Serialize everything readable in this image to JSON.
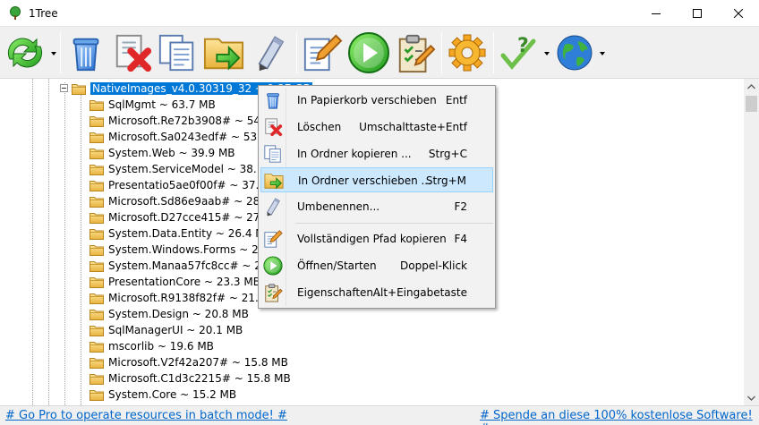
{
  "window": {
    "title": "1Tree"
  },
  "toolbar": {
    "buttons": [
      {
        "id": "refresh",
        "icon": "refresh-icon",
        "has_dropdown": true
      },
      {
        "id": "recycle",
        "icon": "recycle-bin-icon"
      },
      {
        "id": "delete",
        "icon": "delete-icon"
      },
      {
        "id": "copy",
        "icon": "copy-icon"
      },
      {
        "id": "move",
        "icon": "move-folder-icon"
      },
      {
        "id": "rename",
        "icon": "pencil-icon"
      },
      {
        "id": "copy-path",
        "icon": "edit-document-icon"
      },
      {
        "id": "open",
        "icon": "play-icon"
      },
      {
        "id": "properties",
        "icon": "clipboard-icon"
      },
      {
        "id": "settings",
        "icon": "gear-icon"
      },
      {
        "id": "help",
        "icon": "help-icon",
        "has_dropdown": true
      },
      {
        "id": "web",
        "icon": "globe-icon",
        "has_dropdown": true
      }
    ]
  },
  "tree": {
    "root": "NativeImages_v4.0.30319_32 ~ 1.37 GB",
    "items": [
      "SqlMgmt ~ 63.7 MB",
      "Microsoft.Re72b3908# ~ 54.6 MB",
      "Microsoft.Sa0243edf# ~ 53.9 MB",
      "System.Web ~ 39.9 MB",
      "System.ServiceModel ~ 38.1 MB",
      "Presentatio5ae0f00f# ~ 37.9 MB",
      "Microsoft.Sd86e9aab# ~ 28.7 MB",
      "Microsoft.D27cce415# ~ 27.8 MB",
      "System.Data.Entity ~ 26.4 MB",
      "System.Windows.Forms ~ 26.1 MB",
      "System.Manaa57fc8cc# ~ 24.9 MB",
      "PresentationCore ~ 23.3 MB",
      "Microsoft.R9138f82f# ~ 21.5 MB",
      "System.Design ~ 20.8 MB",
      "SqlManagerUI ~ 20.1 MB",
      "mscorlib ~ 19.6 MB",
      "Microsoft.V2f42a207# ~ 15.8 MB",
      "Microsoft.C1d3c2215# ~ 15.8 MB",
      "System.Core ~ 15.2 MB"
    ]
  },
  "context_menu": {
    "items": [
      {
        "label": "In Papierkorb verschieben",
        "shortcut": "Entf",
        "icon": "recycle-bin-icon"
      },
      {
        "label": "Löschen",
        "shortcut": "Umschalttaste+Entf",
        "icon": "delete-icon"
      },
      {
        "label": "In Ordner kopieren ...",
        "shortcut": "Strg+C",
        "icon": "copy-icon"
      },
      {
        "label": "In Ordner verschieben ...",
        "shortcut": "Strg+M",
        "icon": "move-folder-icon",
        "highlighted": true
      },
      {
        "label": "Umbenennen...",
        "shortcut": "F2",
        "icon": "pencil-icon"
      },
      {
        "label": "Vollständigen Pfad kopieren",
        "shortcut": "F4",
        "icon": "edit-document-icon"
      },
      {
        "label": "Öffnen/Starten",
        "shortcut": "Doppel-Klick",
        "icon": "play-icon"
      },
      {
        "label": "Eigenschaften ...",
        "shortcut": "Alt+Eingabetaste",
        "icon": "clipboard-icon"
      }
    ]
  },
  "status": {
    "left_link": "# Go Pro to operate resources in batch mode! #",
    "right_link": "# Spende an diese 100% kostenlose Software! #"
  },
  "colors": {
    "selection": "#0078d7",
    "menu_highlight": "#cce8ff",
    "link": "#0066cc",
    "folder": "#f5c85a"
  }
}
